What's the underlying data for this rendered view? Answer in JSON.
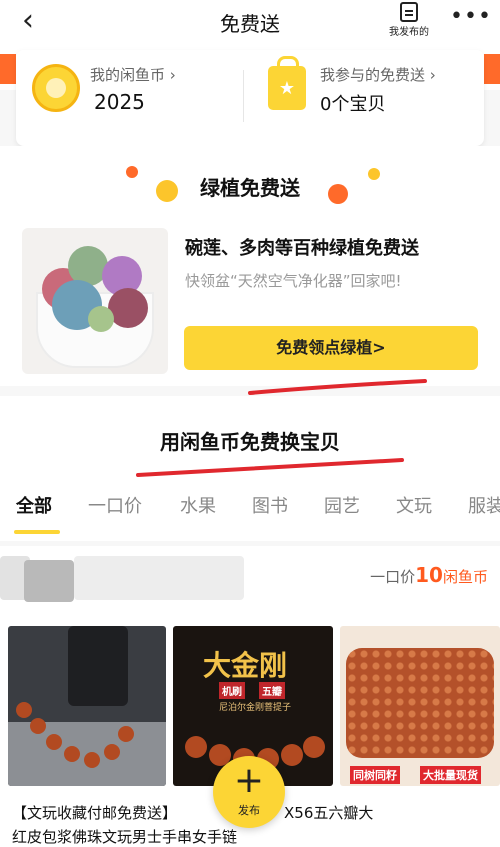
{
  "nav": {
    "back_glyph": "‹",
    "title": "免费送",
    "my_posts_label": "我发布的",
    "more_glyph": "•••"
  },
  "coin_card": {
    "coins_label": "我的闲鱼币",
    "coins_value": "2025",
    "joined_label": "我参与的免费送",
    "joined_value": "0个宝贝",
    "arrow": "›"
  },
  "green_section": {
    "title": "绿植免费送",
    "promo_title": "碗莲、多肉等百种绿植免费送",
    "promo_subtitle": "快领盆“天然空气净化器”回家吧!",
    "button_label": "免费领点绿植>"
  },
  "exchange": {
    "title": "用闲鱼币免费换宝贝",
    "tabs": [
      "全部",
      "一口价",
      "水果",
      "图书",
      "园艺",
      "文玩",
      "服装"
    ],
    "active_tab": 0
  },
  "item": {
    "price_prefix": "一口价",
    "price_value": "10",
    "price_unit": "闲鱼币",
    "photo2_title": "大金刚",
    "photo2_tag1": "机刷",
    "photo2_tag2": "五瓣",
    "photo2_caption": "尼泊尔金刚菩提子",
    "photo3_left_tag": "同树同籽",
    "photo3_right_tag": "大批量现货",
    "desc_line1": "【文玩收藏付邮免费送】",
    "desc_line1_end": "X56五六瓣大",
    "desc_line2": "红皮包浆佛珠文玩男士手串女手链"
  },
  "fab": {
    "plus": "+",
    "label": "发布"
  },
  "colors": {
    "accent_yellow": "#fcd535",
    "price_orange": "#ff5a1f",
    "strip_orange": "#ff6a2a"
  }
}
